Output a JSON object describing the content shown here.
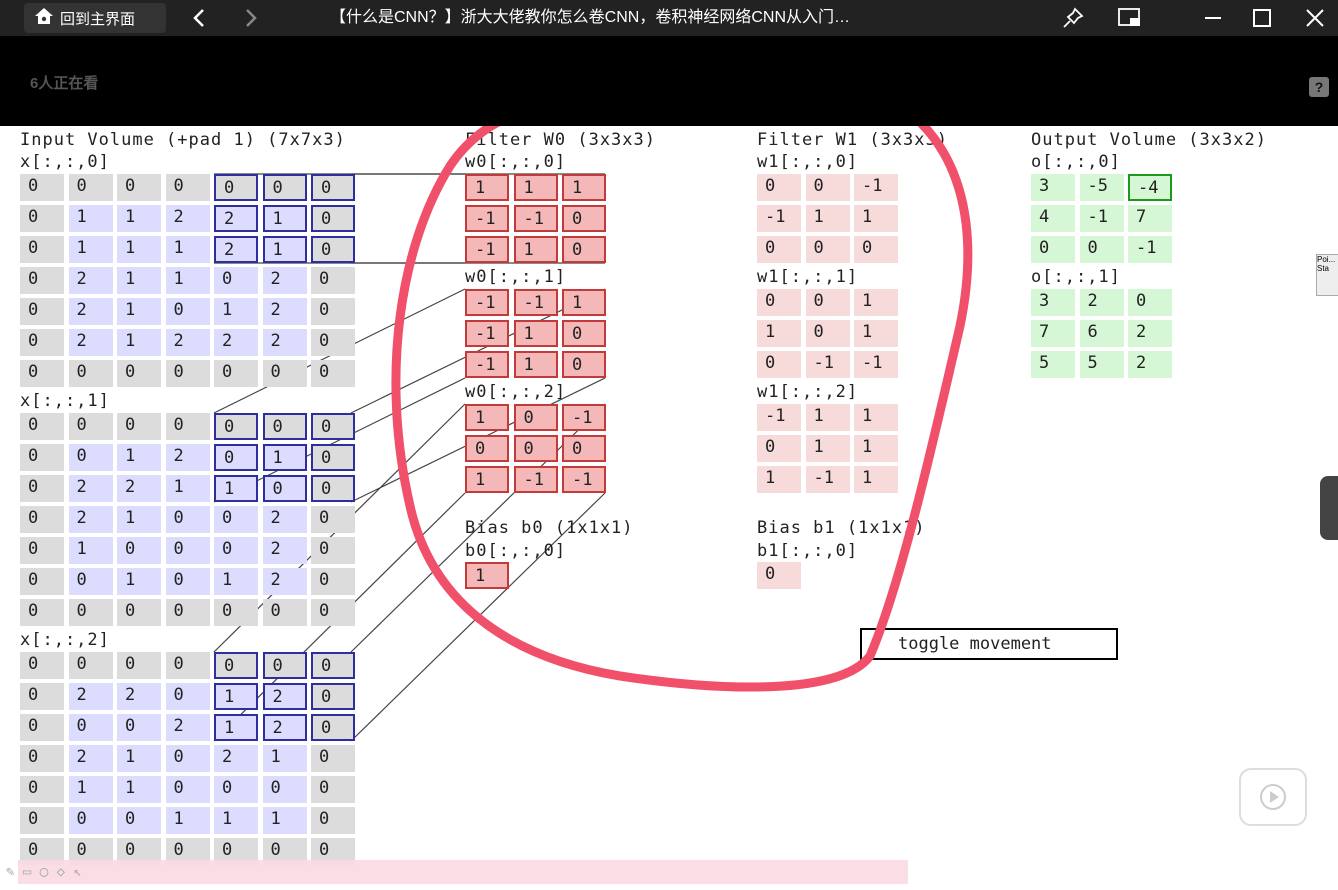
{
  "titlebar": {
    "home_label": "回到主界面",
    "title": "【什么是CNN？】浙大大佬教你怎么卷CNN，卷积神经网络CNN从入门…"
  },
  "video": {
    "watching": "6人正在看",
    "help_label": "?"
  },
  "input": {
    "title": "Input Volume (+pad 1) (7x7x3)",
    "slices": [
      {
        "label": "x[:,:,0]",
        "rows": [
          [
            "0",
            "0",
            "0",
            "0",
            "0",
            "0",
            "0"
          ],
          [
            "0",
            "1",
            "1",
            "2",
            "2",
            "1",
            "0"
          ],
          [
            "0",
            "1",
            "1",
            "1",
            "2",
            "1",
            "0"
          ],
          [
            "0",
            "2",
            "1",
            "1",
            "0",
            "2",
            "0"
          ],
          [
            "0",
            "2",
            "1",
            "0",
            "1",
            "2",
            "0"
          ],
          [
            "0",
            "2",
            "1",
            "2",
            "2",
            "2",
            "0"
          ],
          [
            "0",
            "0",
            "0",
            "0",
            "0",
            "0",
            "0"
          ]
        ]
      },
      {
        "label": "x[:,:,1]",
        "rows": [
          [
            "0",
            "0",
            "0",
            "0",
            "0",
            "0",
            "0"
          ],
          [
            "0",
            "0",
            "1",
            "2",
            "0",
            "1",
            "0"
          ],
          [
            "0",
            "2",
            "2",
            "1",
            "1",
            "0",
            "0"
          ],
          [
            "0",
            "2",
            "1",
            "0",
            "0",
            "2",
            "0"
          ],
          [
            "0",
            "1",
            "0",
            "0",
            "0",
            "2",
            "0"
          ],
          [
            "0",
            "0",
            "1",
            "0",
            "1",
            "2",
            "0"
          ],
          [
            "0",
            "0",
            "0",
            "0",
            "0",
            "0",
            "0"
          ]
        ]
      },
      {
        "label": "x[:,:,2]",
        "rows": [
          [
            "0",
            "0",
            "0",
            "0",
            "0",
            "0",
            "0"
          ],
          [
            "0",
            "2",
            "2",
            "0",
            "1",
            "2",
            "0"
          ],
          [
            "0",
            "0",
            "0",
            "2",
            "1",
            "2",
            "0"
          ],
          [
            "0",
            "2",
            "1",
            "0",
            "2",
            "1",
            "0"
          ],
          [
            "0",
            "1",
            "1",
            "0",
            "0",
            "0",
            "0"
          ],
          [
            "0",
            "0",
            "0",
            "1",
            "1",
            "1",
            "0"
          ],
          [
            "0",
            "0",
            "0",
            "0",
            "0",
            "0",
            "0"
          ]
        ]
      }
    ]
  },
  "filter_w0": {
    "title": "Filter W0 (3x3x3)",
    "slices": [
      {
        "label": "w0[:,:,0]",
        "rows": [
          [
            "1",
            "1",
            "1"
          ],
          [
            "-1",
            "-1",
            "0"
          ],
          [
            "-1",
            "1",
            "0"
          ]
        ]
      },
      {
        "label": "w0[:,:,1]",
        "rows": [
          [
            "-1",
            "-1",
            "1"
          ],
          [
            "-1",
            "1",
            "0"
          ],
          [
            "-1",
            "1",
            "0"
          ]
        ]
      },
      {
        "label": "w0[:,:,2]",
        "rows": [
          [
            "1",
            "0",
            "-1"
          ],
          [
            "0",
            "0",
            "0"
          ],
          [
            "1",
            "-1",
            "-1"
          ]
        ]
      }
    ],
    "bias_title": "Bias b0 (1x1x1)",
    "bias_label": "b0[:,:,0]",
    "bias_value": "1"
  },
  "filter_w1": {
    "title": "Filter W1 (3x3x3)",
    "slices": [
      {
        "label": "w1[:,:,0]",
        "rows": [
          [
            "0",
            "0",
            "-1"
          ],
          [
            "-1",
            "1",
            "1"
          ],
          [
            "0",
            "0",
            "0"
          ]
        ]
      },
      {
        "label": "w1[:,:,1]",
        "rows": [
          [
            "0",
            "0",
            "1"
          ],
          [
            "1",
            "0",
            "1"
          ],
          [
            "0",
            "-1",
            "-1"
          ]
        ]
      },
      {
        "label": "w1[:,:,2]",
        "rows": [
          [
            "-1",
            "1",
            "1"
          ],
          [
            "0",
            "1",
            "1"
          ],
          [
            "1",
            "-1",
            "1"
          ]
        ]
      }
    ],
    "bias_title": "Bias b1 (1x1x1)",
    "bias_label": "b1[:,:,0]",
    "bias_value": "0"
  },
  "output": {
    "title": "Output Volume (3x3x2)",
    "slices": [
      {
        "label": "o[:,:,0]",
        "rows": [
          [
            "3",
            "-5",
            "-4"
          ],
          [
            "4",
            "-1",
            "7"
          ],
          [
            "0",
            "0",
            "-1"
          ]
        ]
      },
      {
        "label": "o[:,:,1]",
        "rows": [
          [
            "3",
            "2",
            "0"
          ],
          [
            "7",
            "6",
            "2"
          ],
          [
            "5",
            "5",
            "2"
          ]
        ]
      }
    ]
  },
  "toggle_label": "toggle movement",
  "corner_box": {
    "line1": "Poi...",
    "line2": "Sta"
  },
  "colors": {
    "annotation_circle": "#f0506a",
    "selection_blue": "#2e2e9e",
    "filter_red": "#c23a3a",
    "output_green": "#1a9a1a"
  }
}
